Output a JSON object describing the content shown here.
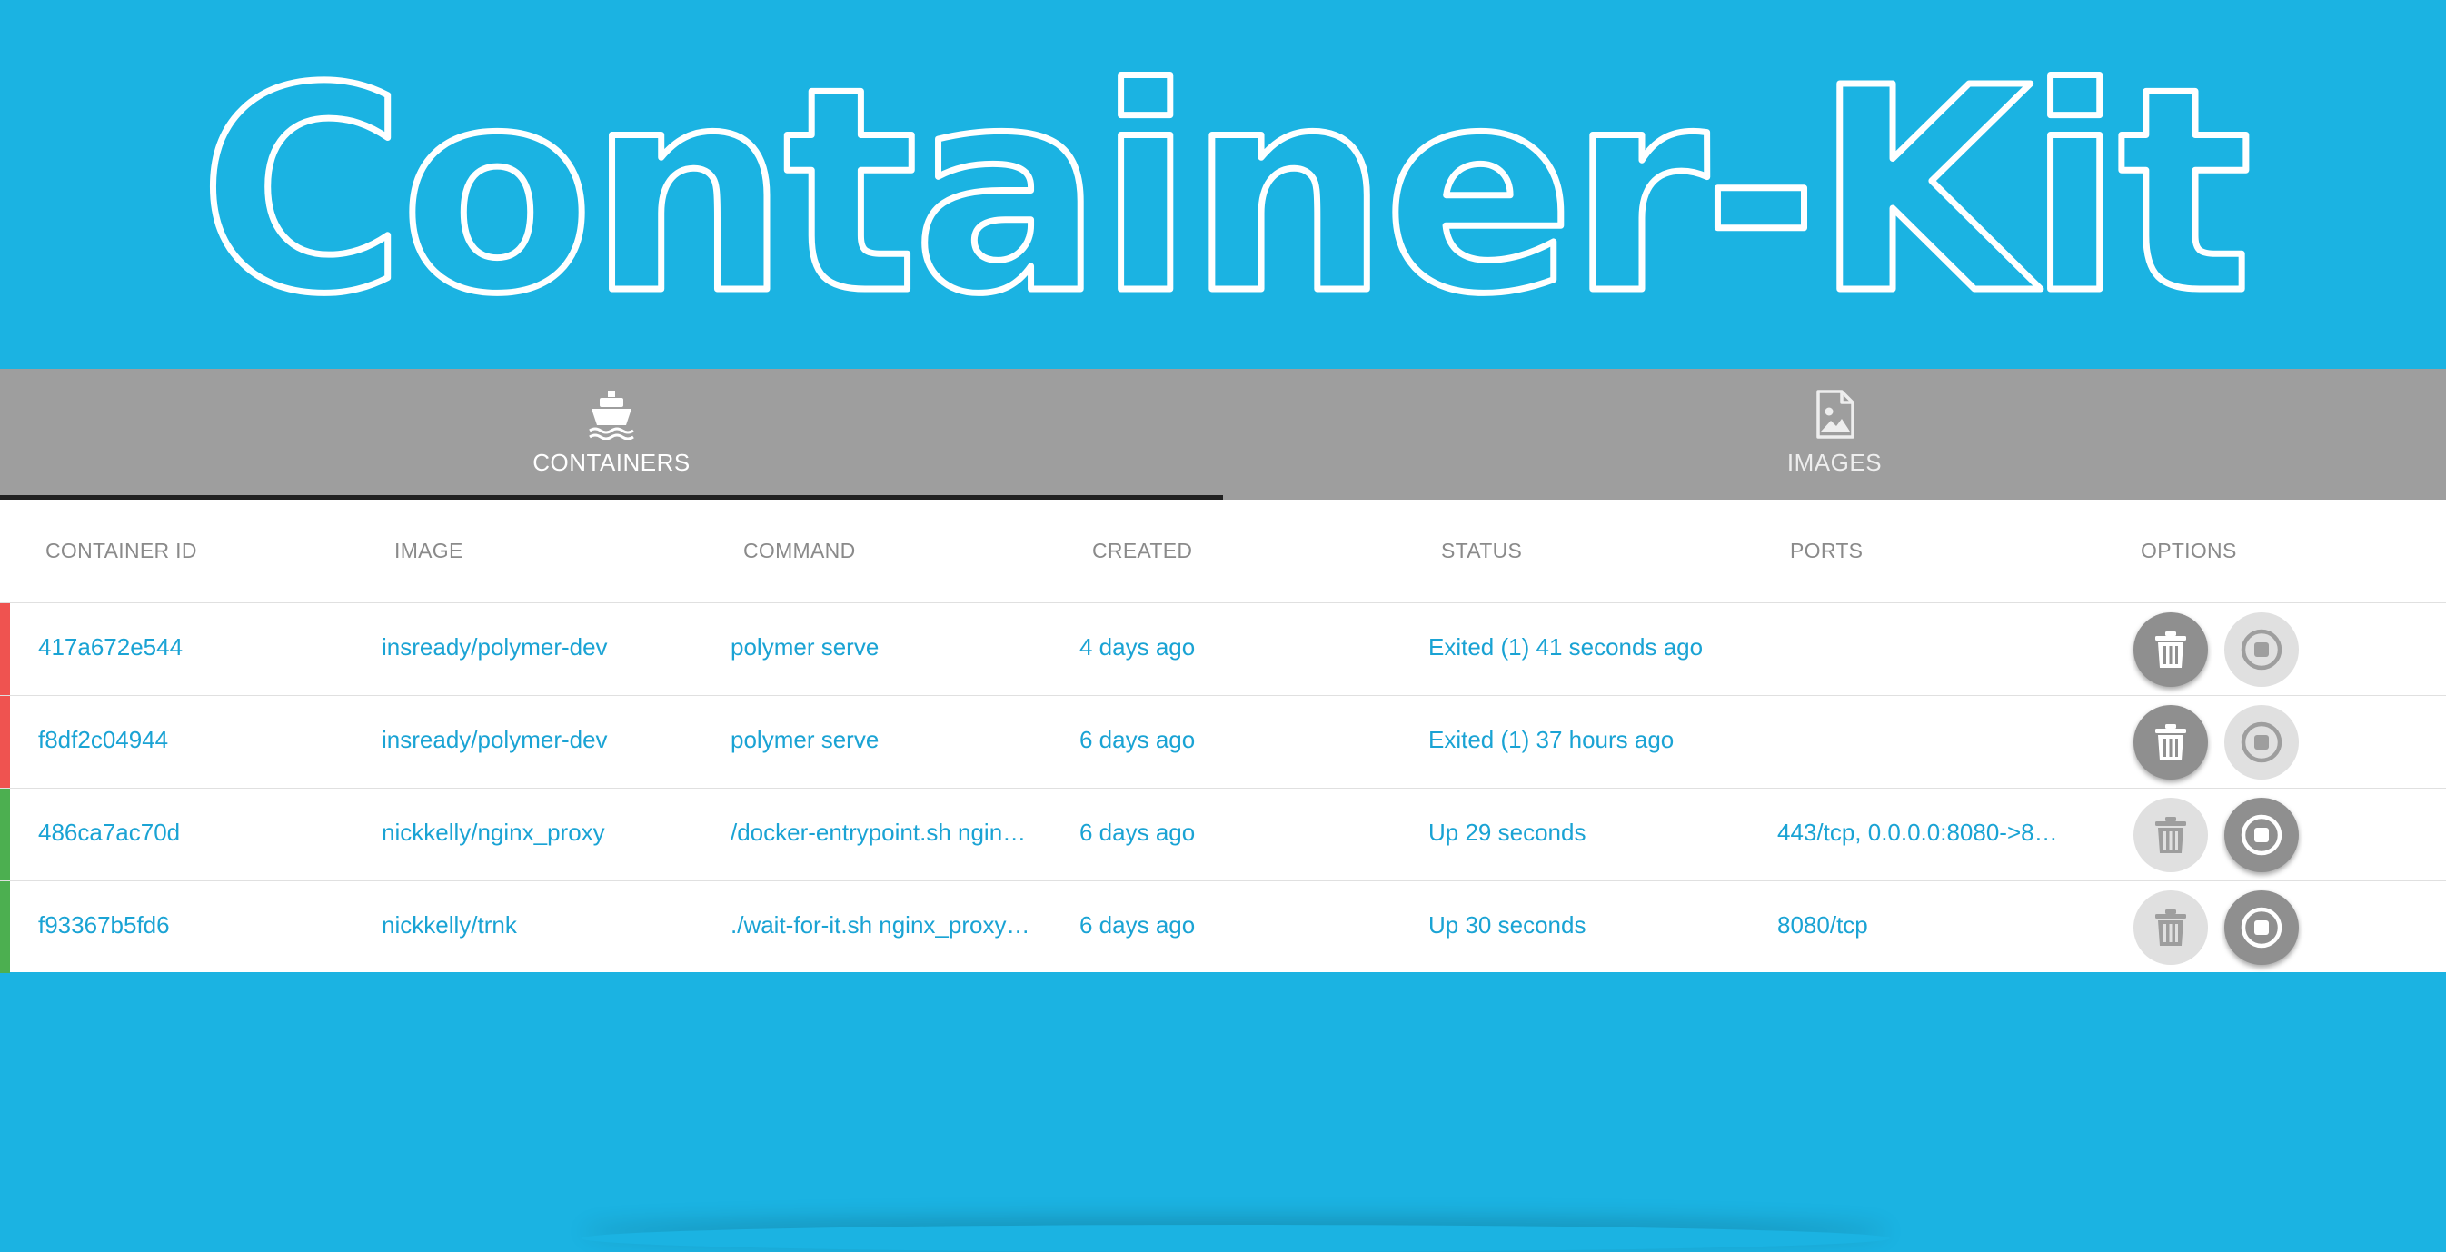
{
  "app": {
    "title": "Container-Kit"
  },
  "tabs": [
    {
      "label": "CONTAINERS",
      "icon": "ship-icon",
      "active": true
    },
    {
      "label": "IMAGES",
      "icon": "image-file-icon",
      "active": false
    }
  ],
  "table": {
    "headers": [
      "CONTAINER ID",
      "IMAGE",
      "COMMAND",
      "CREATED",
      "STATUS",
      "PORTS",
      "OPTIONS"
    ],
    "rows": [
      {
        "id": "417a672e544",
        "image": "insready/polymer-dev",
        "command": "polymer serve",
        "created": "4 days ago",
        "status": "Exited (1) 41 seconds ago",
        "ports": "",
        "state": "exited"
      },
      {
        "id": "f8df2c04944",
        "image": "insready/polymer-dev",
        "command": "polymer serve",
        "created": "6 days ago",
        "status": "Exited (1) 37 hours ago",
        "ports": "",
        "state": "exited"
      },
      {
        "id": "486ca7ac70d",
        "image": "nickkelly/nginx_proxy",
        "command": "/docker-entrypoint.sh ngin…",
        "created": "6 days ago",
        "status": "Up 29 seconds",
        "ports": "443/tcp, 0.0.0.0:8080->80…",
        "state": "running"
      },
      {
        "id": "f93367b5fd6",
        "image": "nickkelly/trnk",
        "command": "./wait-for-it.sh nginx_proxy…",
        "created": "6 days ago",
        "status": "Up 30 seconds",
        "ports": "8080/tcp",
        "state": "running"
      }
    ]
  },
  "colors": {
    "background": "#1bb3e2",
    "tab_bar": "#9e9e9e",
    "cell_text": "#1aa3d4",
    "exited_indicator": "#ef5350",
    "running_indicator": "#4caf50"
  }
}
